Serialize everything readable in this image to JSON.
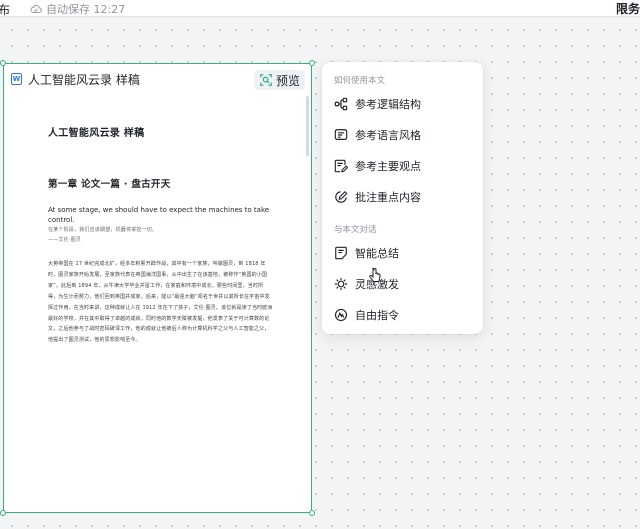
{
  "topbar": {
    "left_text": "布",
    "autosave_text": "自动保存 12:27",
    "right_text": "限务"
  },
  "document": {
    "file_title": "人工智能风云录 样稿",
    "preview_label": "预览",
    "title": "人工智能风云录 样稿",
    "chapter": "第一章 论文一篇 · 盘古开天",
    "quote_en": "At some stage, we should have to expect the machines to take control.",
    "quote_zh": "在某个阶段，我们应该期望，机器将掌控一切。",
    "quote_author": "——艾伦·图灵",
    "paragraph": "大英帝国在 17 世纪完成北扩，经多年积累开辟作战，其中有一个家族，叫做图灵，到 1818 年时，图灵家族开始发展，至家族代表在帝国海洋国事，从中出生了在该基地，被称作“英国的小国家”。此后到 1894 年，从牛津大学毕业并留工作，在家庭和环境中成长。那些时间里，当时所得，为生计而努力，他们回到英国并成家。后来，能以“最强大脑”闻名于世并以其所长在宇宙中发挥过作用，在当时来讲，这种成就让人在 1912 年在下了孩子，艾伦·图灵。该位就是读了当时欧洲最好的学校，并在其中取得了卓越的成绩，同时他的数学天赋被发掘，他发表了关于可计算数的论文，之后他参与了战时密码破译工作，他的成就让他被后人称为计算机科学之父与人工智能之父，他提出了图灵测试，他的思想影响至今。"
  },
  "menu": {
    "section1_label": "如何使用本文",
    "items1": [
      {
        "label": "参考逻辑结构",
        "icon": "logic-structure-icon"
      },
      {
        "label": "参考语言风格",
        "icon": "language-style-icon"
      },
      {
        "label": "参考主要观点",
        "icon": "main-points-icon"
      },
      {
        "label": "批注重点内容",
        "icon": "annotate-icon"
      }
    ],
    "section2_label": "与本文对话",
    "items2": [
      {
        "label": "智能总结",
        "icon": "summary-icon"
      },
      {
        "label": "灵感激发",
        "icon": "inspiration-icon"
      },
      {
        "label": "自由指令",
        "icon": "free-command-icon"
      }
    ]
  },
  "colors": {
    "selection_border": "#34b07a",
    "accent_blue": "#3370ff"
  }
}
